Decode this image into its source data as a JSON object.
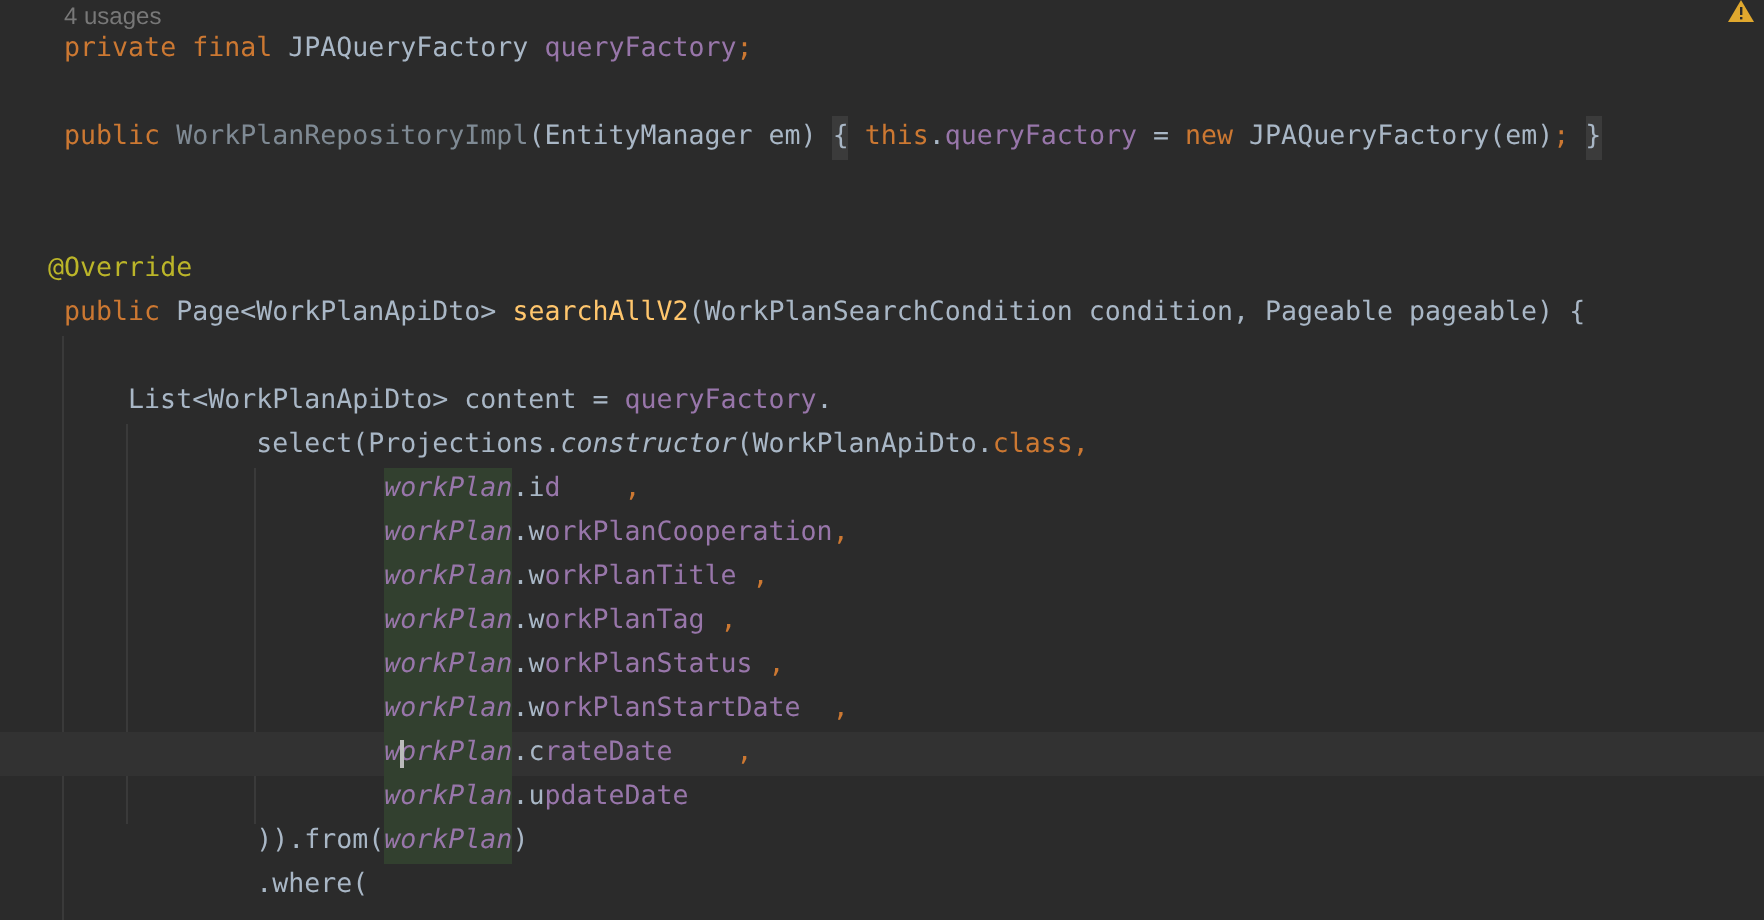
{
  "editor": {
    "inlay_hint": "4 usages",
    "lines": [
      {
        "kind": "code",
        "current": false,
        "tokens": [
          {
            "text": "    private final ",
            "kind": "keyword"
          },
          {
            "text": "JPAQueryFactory ",
            "kind": "plain"
          },
          {
            "text": "queryFactory",
            "kind": "field"
          },
          {
            "text": ";",
            "kind": "keyword"
          }
        ]
      },
      {
        "kind": "blank"
      },
      {
        "kind": "code",
        "current": false,
        "tokens": [
          {
            "text": "    public ",
            "kind": "keyword"
          },
          {
            "text": "WorkPlanRepositoryImpl",
            "kind": "unused"
          },
          {
            "text": "(EntityManager em) ",
            "kind": "plain"
          },
          {
            "text": "{",
            "kind": "folded"
          },
          {
            "text": " this",
            "kind": "keyword"
          },
          {
            "text": ".",
            "kind": "plain"
          },
          {
            "text": "queryFactory",
            "kind": "field"
          },
          {
            "text": " = ",
            "kind": "plain"
          },
          {
            "text": "new",
            "kind": "keyword"
          },
          {
            "text": " JPAQueryFactory(em)",
            "kind": "plain"
          },
          {
            "text": "; ",
            "kind": "keyword"
          },
          {
            "text": "}",
            "kind": "folded"
          }
        ]
      },
      {
        "kind": "blank"
      },
      {
        "kind": "blank"
      },
      {
        "kind": "code",
        "current": false,
        "tokens": [
          {
            "text": "   @Override",
            "kind": "annotation"
          }
        ]
      },
      {
        "kind": "code",
        "current": false,
        "tokens": [
          {
            "text": "    public ",
            "kind": "keyword"
          },
          {
            "text": "Page<WorkPlanApiDto> ",
            "kind": "plain"
          },
          {
            "text": "searchAllV2",
            "kind": "method"
          },
          {
            "text": "(WorkPlanSearchCondition condition, Pageable pageable) {",
            "kind": "plain"
          }
        ]
      },
      {
        "kind": "blank"
      },
      {
        "kind": "code",
        "current": false,
        "tokens": [
          {
            "text": "        List<WorkPlanApiDto> content = ",
            "kind": "plain"
          },
          {
            "text": "queryFactory",
            "kind": "field"
          },
          {
            "text": ".",
            "kind": "plain"
          }
        ]
      },
      {
        "kind": "code",
        "current": false,
        "tokens": [
          {
            "text": "                select(Projections.",
            "kind": "plain"
          },
          {
            "text": "constructor",
            "kind": "static-call"
          },
          {
            "text": "(WorkPlanApiDto.",
            "kind": "plain"
          },
          {
            "text": "class,",
            "kind": "keyword"
          }
        ]
      },
      {
        "kind": "code",
        "current": false,
        "tokens": [
          {
            "text": "                        workPlan",
            "kind": "local-usage"
          },
          {
            "text": ".id",
            "kind": "member"
          },
          {
            "text": "    ,",
            "kind": "keyword"
          }
        ]
      },
      {
        "kind": "code",
        "current": false,
        "tokens": [
          {
            "text": "                        workPlan",
            "kind": "local-usage"
          },
          {
            "text": ".workPlanCooperation",
            "kind": "member"
          },
          {
            "text": ",",
            "kind": "keyword"
          }
        ]
      },
      {
        "kind": "code",
        "current": false,
        "tokens": [
          {
            "text": "                        workPlan",
            "kind": "local-usage"
          },
          {
            "text": ".workPlanTitle",
            "kind": "member"
          },
          {
            "text": " ,",
            "kind": "keyword"
          }
        ]
      },
      {
        "kind": "code",
        "current": false,
        "tokens": [
          {
            "text": "                        workPlan",
            "kind": "local-usage"
          },
          {
            "text": ".workPlanTag",
            "kind": "member"
          },
          {
            "text": " ,",
            "kind": "keyword"
          }
        ]
      },
      {
        "kind": "code",
        "current": false,
        "tokens": [
          {
            "text": "                        workPlan",
            "kind": "local-usage"
          },
          {
            "text": ".workPlanStatus",
            "kind": "member"
          },
          {
            "text": " ,",
            "kind": "keyword"
          }
        ]
      },
      {
        "kind": "code",
        "current": false,
        "tokens": [
          {
            "text": "                        workPlan",
            "kind": "local-usage"
          },
          {
            "text": ".workPlanStartDate",
            "kind": "member"
          },
          {
            "text": "  ,",
            "kind": "keyword"
          }
        ]
      },
      {
        "kind": "code",
        "current": true,
        "tokens": [
          {
            "text": "                        workPlan",
            "kind": "local-usage"
          },
          {
            "text": ".crateDate",
            "kind": "member"
          },
          {
            "text": "    ,",
            "kind": "keyword"
          }
        ]
      },
      {
        "kind": "code",
        "current": false,
        "tokens": [
          {
            "text": "                        workPlan",
            "kind": "local-usage"
          },
          {
            "text": ".updateDate",
            "kind": "member"
          }
        ]
      },
      {
        "kind": "code",
        "current": false,
        "tokens": [
          {
            "text": "                )).from(",
            "kind": "plain"
          },
          {
            "text": "workPlan",
            "kind": "local-usage"
          },
          {
            "text": ")",
            "kind": "plain"
          }
        ]
      },
      {
        "kind": "code",
        "current": false,
        "tokens": [
          {
            "text": "                .where(",
            "kind": "plain"
          }
        ]
      }
    ]
  }
}
